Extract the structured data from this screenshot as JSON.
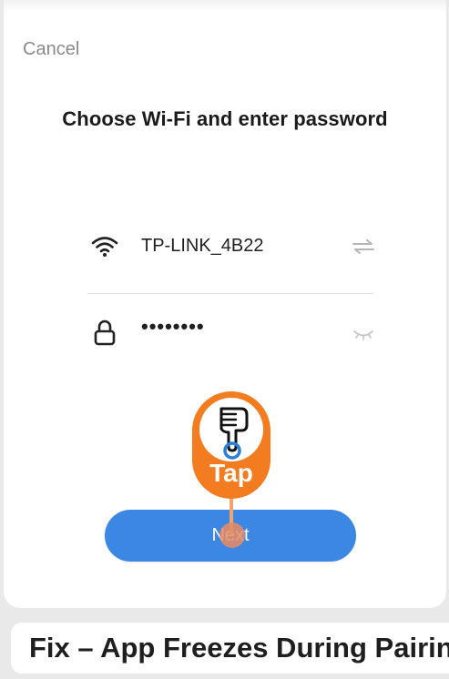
{
  "header": {
    "cancel_label": "Cancel",
    "title": "Choose Wi-Fi and enter password"
  },
  "wifi": {
    "ssid": "TP-LINK_4B22",
    "icon": "wifi-icon",
    "switch_icon": "switch-network-icon"
  },
  "password": {
    "masked_value": "••••••••",
    "icon": "lock-icon",
    "toggle_icon": "eye-closed-icon"
  },
  "actions": {
    "next_label": "Next"
  },
  "overlay": {
    "tap_label": "Tap",
    "hand_icon": "pointing-hand-icon",
    "accent_color": "#f47c20"
  },
  "banner": {
    "text": "Fix – App Freezes During Pairing"
  },
  "colors": {
    "primary_button": "#3b87e3",
    "background": "#ffffff",
    "muted_text": "#8a8a8a"
  }
}
